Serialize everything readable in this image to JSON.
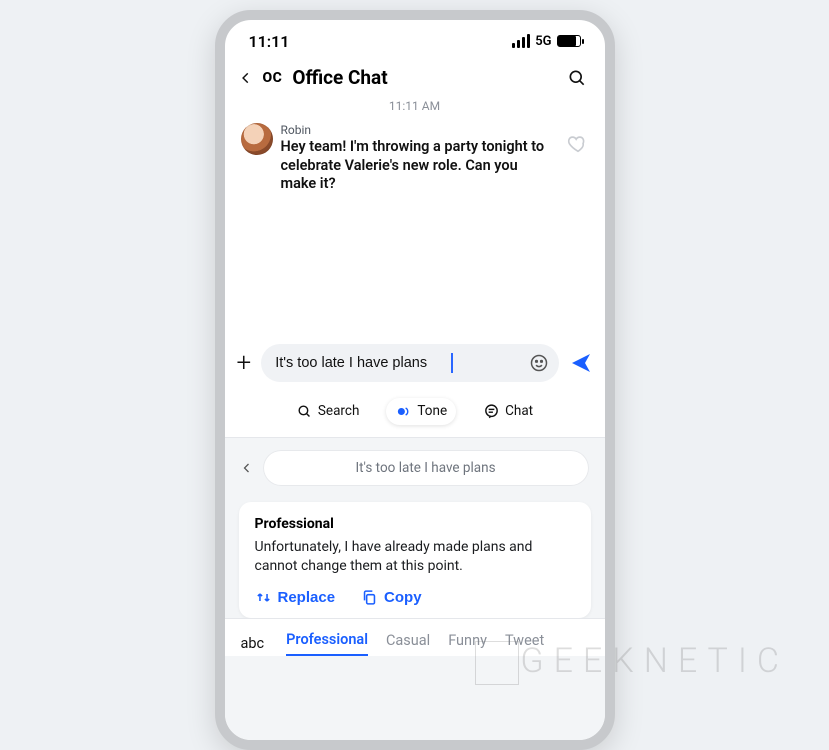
{
  "status": {
    "time": "11:11",
    "network": "5G"
  },
  "header": {
    "avatar_initials": "OC",
    "title": "Office Chat"
  },
  "thread": {
    "timestamp": "11:11 AM",
    "message": {
      "sender": "Robin",
      "text": "Hey team! I'm throwing a party tonight to celebrate Valerie's new role. Can you make it?"
    }
  },
  "composer": {
    "draft": "It's too late I have plans"
  },
  "keyboard_toolbar": {
    "search": "Search",
    "tone": "Tone",
    "chat": "Chat"
  },
  "tone_panel": {
    "echo": "It's too late I have plans",
    "card_title": "Professional",
    "card_body": "Unfortunately, I have already made plans and cannot change them at this point.",
    "replace": "Replace",
    "copy": "Copy"
  },
  "tone_tabs": {
    "abc": "abc",
    "items": [
      "Professional",
      "Casual",
      "Funny",
      "Tweet"
    ],
    "selected": "Professional"
  },
  "watermark": "GEEKNETIC"
}
